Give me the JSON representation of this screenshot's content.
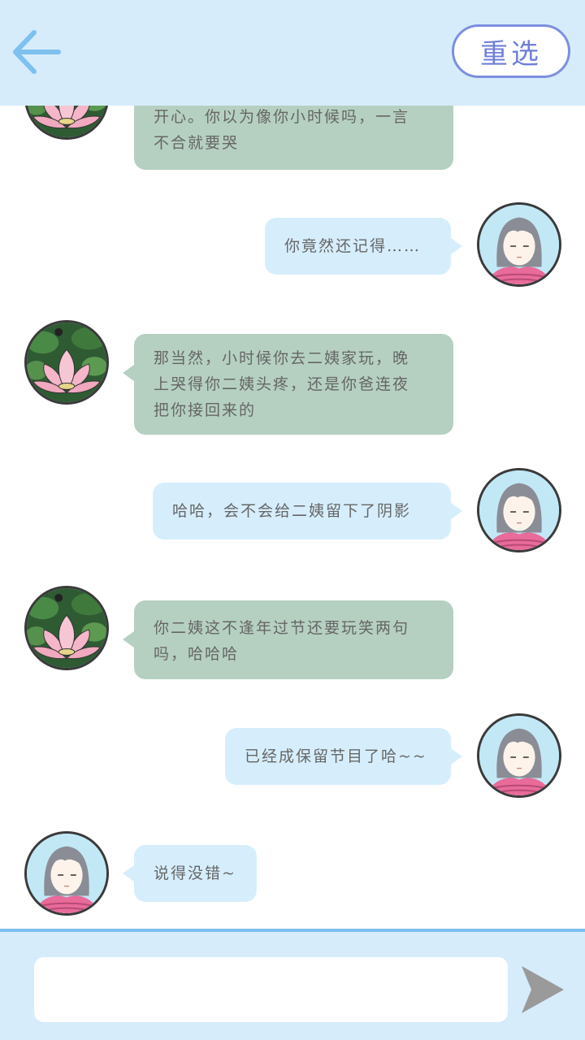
{
  "header": {
    "back_icon": "arrow-left-icon",
    "reselect_label": "重选"
  },
  "messages": [
    {
      "side": "left",
      "avatar": "lotus-avatar",
      "lines": [
        "开心。你以为像你小时候吗，一言",
        "不合就要哭"
      ]
    },
    {
      "side": "right",
      "avatar": "girl-avatar",
      "lines": [
        "你竟然还记得……"
      ]
    },
    {
      "side": "left",
      "avatar": "lotus-avatar",
      "lines": [
        "那当然，小时候你去二姨家玩，晚",
        "上哭得你二姨头疼，还是你爸连夜",
        "把你接回来的"
      ]
    },
    {
      "side": "right",
      "avatar": "girl-avatar",
      "lines": [
        "哈哈，会不会给二姨留下了阴影"
      ]
    },
    {
      "side": "left",
      "avatar": "lotus-avatar",
      "lines": [
        "你二姨这不逢年过节还要玩笑两句",
        "吗，哈哈哈"
      ]
    },
    {
      "side": "right",
      "avatar": "girl-avatar",
      "lines": [
        "已经成保留节目了哈~~"
      ]
    },
    {
      "side": "left",
      "avatar": "girl-avatar",
      "lines": [
        "说得没错~"
      ]
    }
  ],
  "input": {
    "value": "",
    "placeholder": ""
  },
  "send_icon": "send-icon",
  "colors": {
    "header_bg": "#d6ecfb",
    "accent_blue": "#7ebff0",
    "reselect_border": "#7d8fe0",
    "bubble_green": "#b5d0c1",
    "bubble_blue": "#d6eefc",
    "text_gray": "#666666",
    "send_gray": "#9a9a9a"
  }
}
